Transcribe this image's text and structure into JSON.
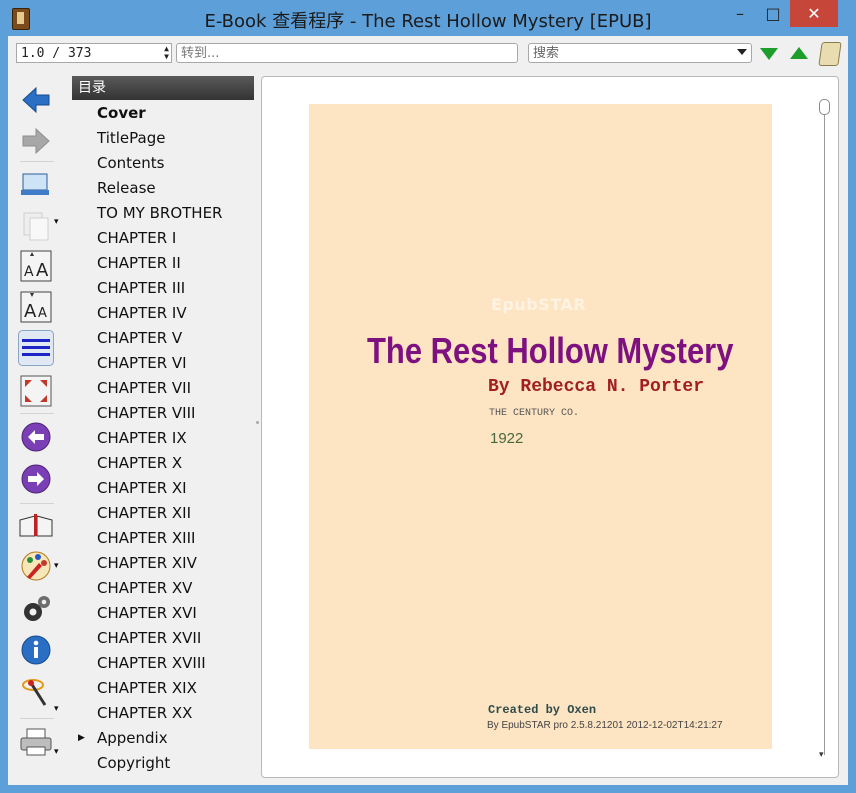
{
  "window": {
    "title": "E-Book 查看程序 - The Rest Hollow Mystery [EPUB]",
    "minimize": "–",
    "maximize": "□",
    "close": "✕"
  },
  "toolbar": {
    "page_value": "1.0 / 373",
    "goto_placeholder": "转到...",
    "search_placeholder": "搜索",
    "next_match_color": "#1d9d2b",
    "prev_match_color": "#1d9d2b"
  },
  "sidebar": {
    "icons": [
      "back-arrow-icon",
      "forward-arrow-icon",
      "library-icon",
      "copy-icon",
      "font-larger-icon",
      "font-smaller-icon",
      "toc-lines-icon",
      "fullscreen-icon",
      "prev-page-icon",
      "next-page-icon",
      "reference-mode-icon",
      "themes-icon",
      "settings-icon",
      "info-icon",
      "tweak-icon",
      "print-icon"
    ]
  },
  "toc": {
    "header": "目录",
    "items": [
      {
        "label": "Cover",
        "bold": true
      },
      {
        "label": "TitlePage"
      },
      {
        "label": "Contents"
      },
      {
        "label": "Release"
      },
      {
        "label": "TO MY BROTHER"
      },
      {
        "label": "CHAPTER I"
      },
      {
        "label": "CHAPTER II"
      },
      {
        "label": "CHAPTER III"
      },
      {
        "label": "CHAPTER IV"
      },
      {
        "label": "CHAPTER V"
      },
      {
        "label": "CHAPTER VI"
      },
      {
        "label": "CHAPTER VII"
      },
      {
        "label": "CHAPTER VIII"
      },
      {
        "label": "CHAPTER IX"
      },
      {
        "label": "CHAPTER X"
      },
      {
        "label": "CHAPTER XI"
      },
      {
        "label": "CHAPTER XII"
      },
      {
        "label": "CHAPTER XIII"
      },
      {
        "label": "CHAPTER XIV"
      },
      {
        "label": "CHAPTER XV"
      },
      {
        "label": "CHAPTER XVI"
      },
      {
        "label": "CHAPTER XVII"
      },
      {
        "label": "CHAPTER XVIII"
      },
      {
        "label": "CHAPTER XIX"
      },
      {
        "label": "CHAPTER XX"
      },
      {
        "label": "Appendix",
        "expandable": true
      },
      {
        "label": "Copyright"
      }
    ]
  },
  "cover": {
    "brand": "EpubSTAR",
    "title": "The Rest Hollow Mystery",
    "author": "By Rebecca N. Porter",
    "publisher": "THE CENTURY CO.",
    "year": "1922",
    "created_by": "Created by Oxen",
    "producer": "By EpubSTAR pro 2.5.8.21201 2012-12-02T14:21:27",
    "background": "#fde4c3",
    "title_color": "#7d1180",
    "author_color": "#a11f1f"
  }
}
